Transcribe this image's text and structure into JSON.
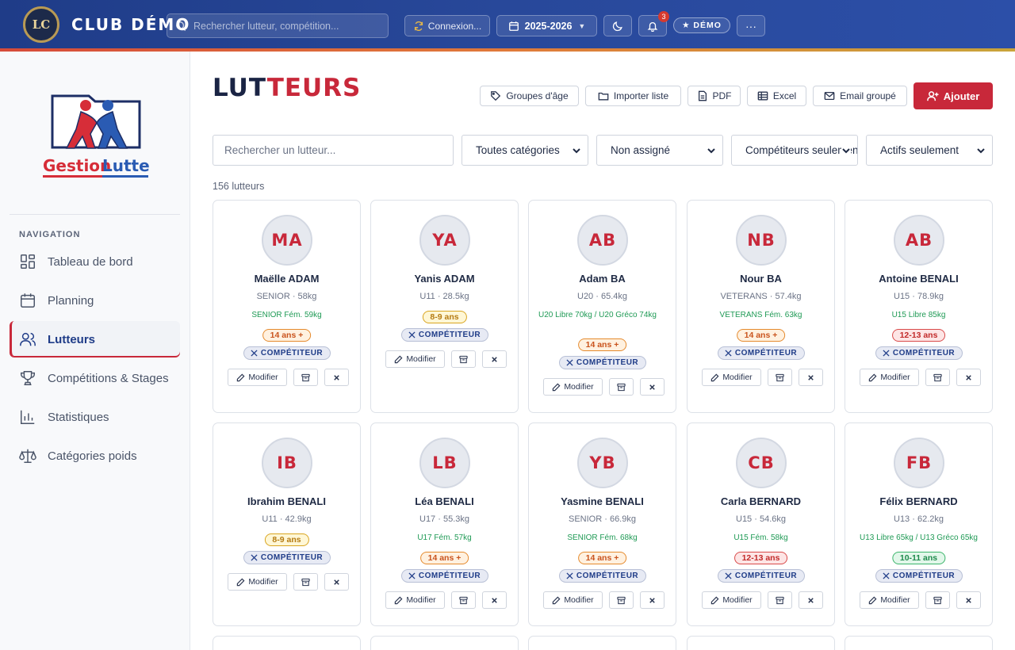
{
  "topbar": {
    "club_initials": "LC",
    "club_name": "CLUB DÉMO",
    "search_placeholder": "Rechercher lutteur, compétition...",
    "connection_label": "Connexion...",
    "season_label": "2025-2026",
    "notifications_count": "3",
    "demo_label": "★ DÉMO",
    "more_label": "···"
  },
  "brand": {
    "name_part1": "Gestion",
    "name_part2": "Lutte"
  },
  "sidebar": {
    "section_label": "NAVIGATION",
    "items": [
      {
        "label": "Tableau de bord",
        "icon": "dashboard-icon"
      },
      {
        "label": "Planning",
        "icon": "calendar-icon"
      },
      {
        "label": "Lutteurs",
        "icon": "users-icon",
        "active": true
      },
      {
        "label": "Compétitions & Stages",
        "icon": "trophy-icon"
      },
      {
        "label": "Statistiques",
        "icon": "chart-icon"
      },
      {
        "label": "Catégories poids",
        "icon": "scale-icon"
      }
    ]
  },
  "page": {
    "title_part1": "LUT",
    "title_part2": "TEURS",
    "actions": {
      "age_groups": "Groupes d'âge",
      "import": "Importer liste",
      "pdf": "PDF",
      "excel": "Excel",
      "email": "Email groupé",
      "add": "Ajouter"
    },
    "filters": {
      "search_placeholder": "Rechercher un lutteur...",
      "category": "Toutes catégories",
      "assignment": "Non assigné",
      "competitors": "Compétiteurs seulement",
      "status": "Actifs seulement"
    },
    "count_label": "156 lutteurs"
  },
  "card_labels": {
    "competitor": "COMPÉTITEUR",
    "edit": "Modifier"
  },
  "wrestlers": [
    {
      "initials": "MA",
      "name": "Maëlle ADAM",
      "meta": "SENIOR · 58kg",
      "category": "SENIOR Fém. 59kg",
      "age": "14 ans +"
    },
    {
      "initials": "YA",
      "name": "Yanis ADAM",
      "meta": "U11 · 28.5kg",
      "category": "",
      "age": "8-9 ans"
    },
    {
      "initials": "AB",
      "name": "Adam BA",
      "meta": "U20 · 65.4kg",
      "category": "U20 Libre 70kg / U20 Gréco 74kg",
      "age": "14 ans +"
    },
    {
      "initials": "NB",
      "name": "Nour BA",
      "meta": "VETERANS · 57.4kg",
      "category": "VETERANS Fém. 63kg",
      "age": "14 ans +"
    },
    {
      "initials": "AB",
      "name": "Antoine BENALI",
      "meta": "U15 · 78.9kg",
      "category": "U15 Libre 85kg",
      "age": "12-13 ans"
    },
    {
      "initials": "IB",
      "name": "Ibrahim BENALI",
      "meta": "U11 · 42.9kg",
      "category": "",
      "age": "8-9 ans"
    },
    {
      "initials": "LB",
      "name": "Léa BENALI",
      "meta": "U17 · 55.3kg",
      "category": "U17 Fém. 57kg",
      "age": "14 ans +"
    },
    {
      "initials": "YB",
      "name": "Yasmine BENALI",
      "meta": "SENIOR · 66.9kg",
      "category": "SENIOR Fém. 68kg",
      "age": "14 ans +"
    },
    {
      "initials": "CB",
      "name": "Carla BERNARD",
      "meta": "U15 · 54.6kg",
      "category": "U15 Fém. 58kg",
      "age": "12-13 ans"
    },
    {
      "initials": "FB",
      "name": "Félix BERNARD",
      "meta": "U13 · 62.2kg",
      "category": "U13 Libre 65kg / U13 Gréco 65kg",
      "age": "10-11 ans"
    }
  ],
  "colors": {
    "primary_blue": "#1f3c88",
    "accent_red": "#c8283a",
    "category_green": "#1f9a55",
    "age_14_plus": "#e58a2d",
    "age_12_13": "#d94a4a",
    "age_8_9": "#d9a520",
    "age_10_11": "#3bb56b"
  }
}
